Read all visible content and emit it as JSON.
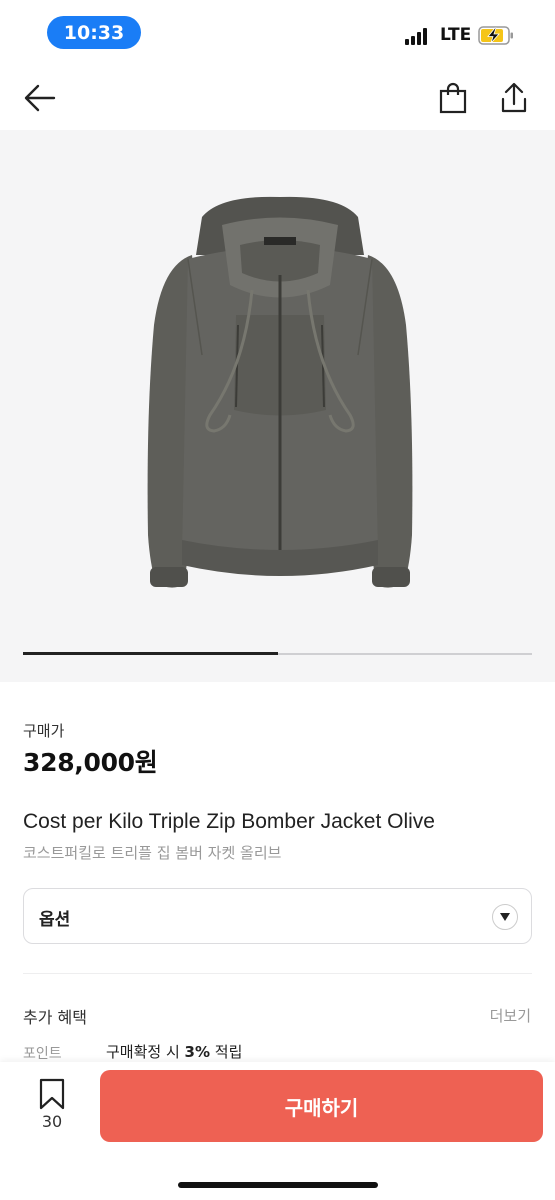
{
  "status_bar": {
    "time": "10:33",
    "network": "LTE",
    "icons": [
      "signal-icon",
      "battery-charging-icon"
    ]
  },
  "nav": {
    "icons": [
      "back-arrow-icon",
      "shopping-bag-icon",
      "share-icon"
    ]
  },
  "gallery": {
    "image_subject": "jacket",
    "progress": 0.5
  },
  "product": {
    "price_label": "구매가",
    "price": "328,000원",
    "name_en": "Cost per Kilo Triple Zip Bomber Jacket Olive",
    "name_ko": "코스트퍼킬로 트리플 집 봄버 자켓 올리브"
  },
  "option": {
    "label": "옵션",
    "icon": "chevron-down-icon"
  },
  "benefits": {
    "title": "추가 혜택",
    "more_label": "더보기",
    "point_label": "포인트",
    "point_text_prefix": "구매확정 시 ",
    "point_rate": "3%",
    "point_text_suffix": " 적립"
  },
  "bottom_bar": {
    "bookmark_count": "30",
    "buy_label": "구매하기"
  },
  "colors": {
    "time_pill": "#1a7df6",
    "buy_button": "#ee6153",
    "hero_bg": "#f5f5f6"
  }
}
